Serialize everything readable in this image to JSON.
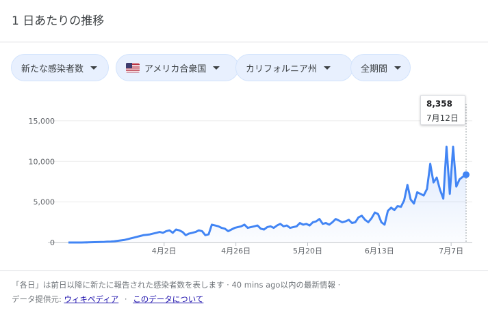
{
  "header": {
    "title": "1 日あたりの推移"
  },
  "filters": {
    "metric": "新たな感染者数",
    "country": "アメリカ合衆国",
    "state": "カリフォルニア州",
    "period": "全期間"
  },
  "tooltip": {
    "value": "8,358",
    "date": "7月12日"
  },
  "footer": {
    "line1": "「各日」は前日以降に新たに報告された感染者数を表します · 40 mins ago以内の最新情報 ·",
    "provider_label": "データ提供元:",
    "wikipedia": "ウィキペディア",
    "dot": "·",
    "about_data": "このデータについて"
  },
  "colors": {
    "line": "#4285f4",
    "accent": "#1a73e8"
  },
  "chart_data": {
    "type": "area",
    "title": "",
    "xlabel": "",
    "ylabel": "",
    "ylim": [
      0,
      16000
    ],
    "yticks": [
      "0",
      "5,000",
      "10,000",
      "15,000"
    ],
    "xticks": [
      "4月2日",
      "4月26日",
      "5月20日",
      "6月13日",
      "7月7日"
    ],
    "grid": true,
    "series": [
      {
        "x_start": "2020-03-01",
        "x_end": "2020-07-12",
        "values": [
          0,
          0,
          0,
          0,
          0,
          10,
          20,
          30,
          40,
          50,
          60,
          80,
          100,
          120,
          150,
          200,
          250,
          300,
          400,
          500,
          600,
          700,
          800,
          900,
          950,
          1000,
          1100,
          1200,
          1300,
          1200,
          1400,
          1500,
          1200,
          1600,
          1500,
          1300,
          900,
          1100,
          1200,
          1300,
          1500,
          1400,
          900,
          1000,
          2200,
          2100,
          2000,
          1800,
          1700,
          1400,
          1600,
          1800,
          1900,
          2000,
          2200,
          1800,
          1900,
          2000,
          2100,
          1700,
          1600,
          1900,
          2000,
          1800,
          2100,
          2300,
          2000,
          2100,
          1800,
          1900,
          2000,
          2400,
          2200,
          2300,
          2100,
          2500,
          2600,
          2900,
          2300,
          2400,
          2200,
          2500,
          2900,
          2700,
          2500,
          2600,
          2800,
          2400,
          2500,
          3100,
          3300,
          2800,
          2500,
          3000,
          3700,
          3500,
          2500,
          2200,
          3900,
          4300,
          4000,
          4500,
          4400,
          5200,
          7100,
          5300,
          4800,
          6200,
          6000,
          5800,
          6600,
          9700,
          7400,
          8000,
          6500,
          5400,
          11800,
          6000,
          11800,
          6900,
          7800,
          8100,
          8358
        ]
      }
    ]
  }
}
